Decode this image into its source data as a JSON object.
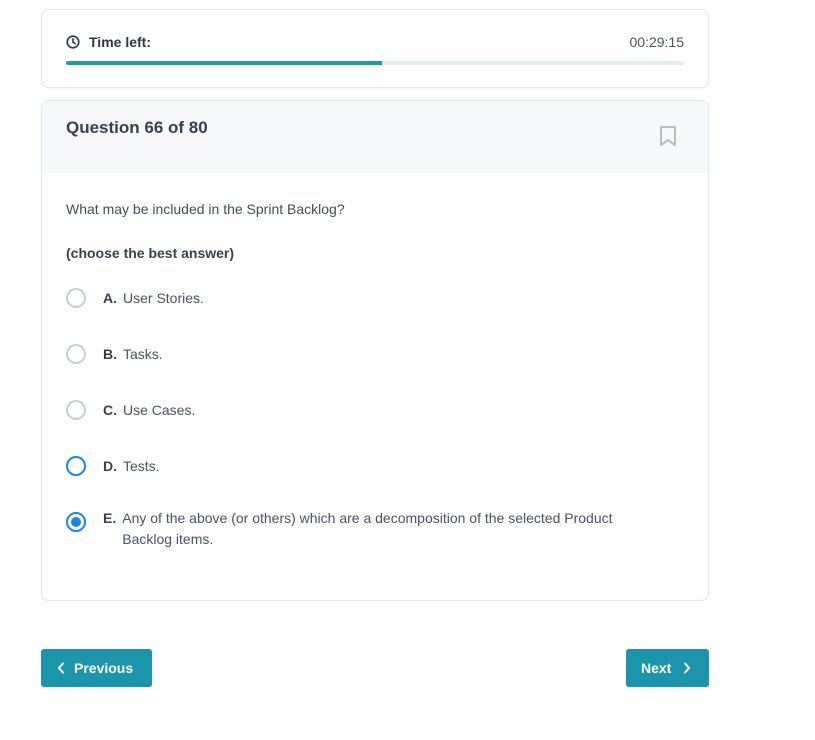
{
  "timer": {
    "label": "Time left:",
    "value": "00:29:15",
    "progress_fraction": 0.512,
    "accent_color": "#1a9aad",
    "icon": "clock-icon"
  },
  "question": {
    "title": "Question 66 of 80",
    "text": "What may be included in the Sprint Backlog?",
    "hint": "(choose the best answer)",
    "bookmark_icon": "bookmark-icon",
    "options": [
      {
        "letter": "A.",
        "text": "User Stories.",
        "state": "unselected"
      },
      {
        "letter": "B.",
        "text": "Tasks.",
        "state": "unselected"
      },
      {
        "letter": "C.",
        "text": "Use Cases.",
        "state": "unselected"
      },
      {
        "letter": "D.",
        "text": "Tests.",
        "state": "focused"
      },
      {
        "letter": "E.",
        "text": "Any of the above (or others) which are a decomposition of the selected Product Backlog items.",
        "state": "selected"
      }
    ]
  },
  "nav": {
    "previous_label": "Previous",
    "next_label": "Next",
    "button_color": "#1a95ab"
  }
}
